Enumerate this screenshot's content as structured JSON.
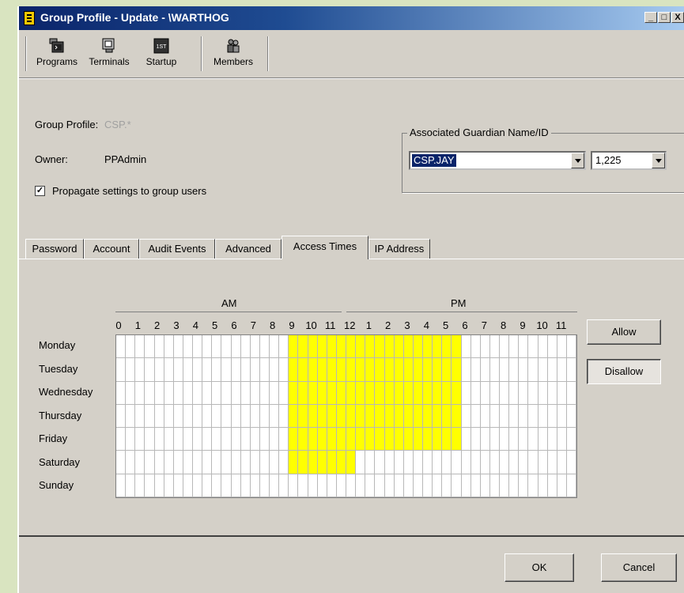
{
  "window": {
    "title": "Group Profile - Update - \\WARTHOG",
    "controls": [
      "_",
      "□",
      "X"
    ]
  },
  "toolbar": {
    "items": [
      {
        "label": "Programs",
        "icon": "programs-icon"
      },
      {
        "label": "Terminals",
        "icon": "terminals-icon"
      },
      {
        "label": "Startup",
        "icon": "startup-icon",
        "icon_text": "1ST"
      },
      {
        "label": "Members",
        "icon": "members-icon"
      }
    ]
  },
  "profile": {
    "group_profile_label": "Group Profile:",
    "group_profile_value": "CSP.*",
    "owner_label": "Owner:",
    "owner_value": "PPAdmin",
    "propagate_label": "Propagate settings to group users",
    "propagate_checked": true
  },
  "guardian": {
    "group_title": "Associated Guardian Name/ID",
    "name_value": "CSP.JAY",
    "id_value": "1,225"
  },
  "tabs": [
    {
      "label": "Password",
      "active": false
    },
    {
      "label": "Account",
      "active": false
    },
    {
      "label": "Audit Events",
      "active": false
    },
    {
      "label": "Advanced",
      "active": false
    },
    {
      "label": "Access Times",
      "active": true
    },
    {
      "label": "IP Address",
      "active": false
    }
  ],
  "access_times": {
    "am_label": "AM",
    "pm_label": "PM",
    "hours": [
      "0",
      "1",
      "2",
      "3",
      "4",
      "5",
      "6",
      "7",
      "8",
      "9",
      "10",
      "11",
      "12",
      "1",
      "2",
      "3",
      "4",
      "5",
      "6",
      "7",
      "8",
      "9",
      "10",
      "11"
    ],
    "days": [
      {
        "name": "Monday",
        "allowed_half_hours": [
          18,
          36
        ]
      },
      {
        "name": "Tuesday",
        "allowed_half_hours": [
          18,
          36
        ]
      },
      {
        "name": "Wednesday",
        "allowed_half_hours": [
          18,
          36
        ]
      },
      {
        "name": "Thursday",
        "allowed_half_hours": [
          18,
          36
        ]
      },
      {
        "name": "Friday",
        "allowed_half_hours": [
          18,
          36
        ]
      },
      {
        "name": "Saturday",
        "allowed_half_hours": [
          18,
          25
        ]
      },
      {
        "name": "Sunday",
        "allowed_half_hours": null
      }
    ],
    "allow_label": "Allow",
    "disallow_label": "Disallow",
    "allowed_color": "#ffff00"
  },
  "footer": {
    "ok_label": "OK",
    "cancel_label": "Cancel"
  }
}
